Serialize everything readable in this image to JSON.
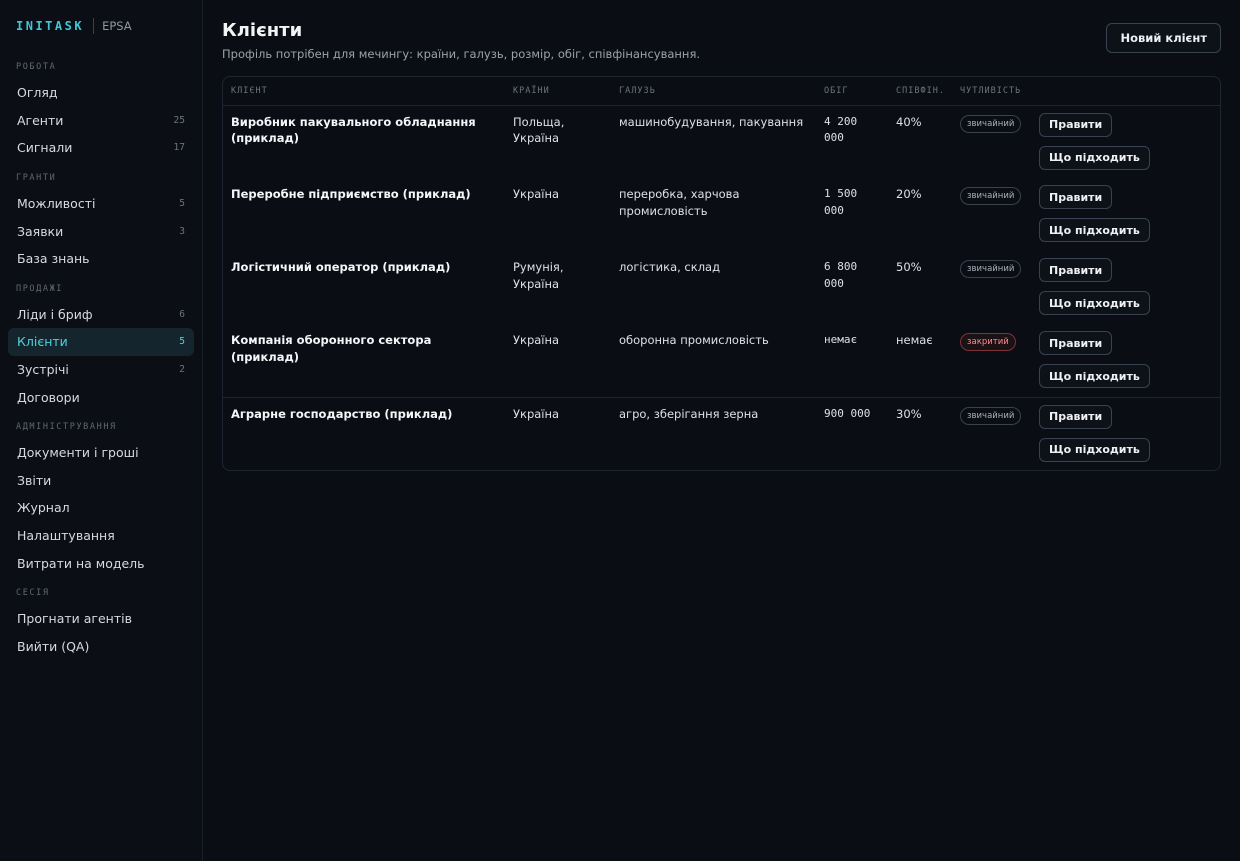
{
  "brand": {
    "logo": "INITASK",
    "org": "EPSA"
  },
  "colors": {
    "accent": "#3ec8d6",
    "active_bg": "#14252d",
    "closed_badge": "#ff8a8f",
    "background": "#0a0e14"
  },
  "sidebar": {
    "sections": [
      {
        "title": "РОБОТА",
        "items": [
          {
            "label": "Огляд",
            "count": ""
          },
          {
            "label": "Агенти",
            "count": "25"
          },
          {
            "label": "Сигнали",
            "count": "17"
          }
        ]
      },
      {
        "title": "ГРАНТИ",
        "items": [
          {
            "label": "Можливості",
            "count": "5"
          },
          {
            "label": "Заявки",
            "count": "3"
          },
          {
            "label": "База знань",
            "count": ""
          }
        ]
      },
      {
        "title": "ПРОДАЖІ",
        "items": [
          {
            "label": "Ліди і бриф",
            "count": "6"
          },
          {
            "label": "Клієнти",
            "count": "5",
            "active": true
          },
          {
            "label": "Зустрічі",
            "count": "2"
          },
          {
            "label": "Договори",
            "count": ""
          }
        ]
      },
      {
        "title": "АДМІНІСТРУВАННЯ",
        "items": [
          {
            "label": "Документи і гроші",
            "count": ""
          },
          {
            "label": "Звіти",
            "count": ""
          },
          {
            "label": "Журнал",
            "count": ""
          },
          {
            "label": "Налаштування",
            "count": ""
          },
          {
            "label": "Витрати на модель",
            "count": ""
          }
        ]
      },
      {
        "title": "СЕСІЯ",
        "items": [
          {
            "label": "Прогнати агентів",
            "count": ""
          },
          {
            "label": "Вийти (QA)",
            "count": ""
          }
        ]
      }
    ]
  },
  "header": {
    "title": "Клієнти",
    "subtitle": "Профіль потрібен для мечингу: країни, галузь, розмір, обіг, співфінансування.",
    "new_client_label": "Новий клієнт"
  },
  "table": {
    "columns": [
      "КЛІЄНТ",
      "КРАЇНИ",
      "ГАЛУЗЬ",
      "ОБІГ",
      "СПІВФІН.",
      "ЧУТЛИВІСТЬ",
      ""
    ],
    "edit_label": "Правити",
    "match_label": "Що підходить",
    "rows": [
      {
        "client": "Виробник пакувального обладнання (приклад)",
        "countries": "Польща, Україна",
        "industry": "машинобудування, пакування",
        "turnover": "4 200 000",
        "cofin": "40%",
        "sensitivity": "звичайний",
        "closed": false
      },
      {
        "client": "Переробне підприємство (приклад)",
        "countries": "Україна",
        "industry": "переробка, харчова промисловість",
        "turnover": "1 500 000",
        "cofin": "20%",
        "sensitivity": "звичайний",
        "closed": false
      },
      {
        "client": "Логістичний оператор (приклад)",
        "countries": "Румунія, Україна",
        "industry": "логістика, склад",
        "turnover": "6 800 000",
        "cofin": "50%",
        "sensitivity": "звичайний",
        "closed": false
      },
      {
        "client": "Компанія оборонного сектора (приклад)",
        "countries": "Україна",
        "industry": "оборонна промисловість",
        "turnover": "немає",
        "cofin": "немає",
        "sensitivity": "закритий",
        "closed": true
      },
      {
        "client": "Аграрне господарство (приклад)",
        "countries": "Україна",
        "industry": "агро, зберігання зерна",
        "turnover": "900 000",
        "cofin": "30%",
        "sensitivity": "звичайний",
        "closed": false
      }
    ]
  }
}
